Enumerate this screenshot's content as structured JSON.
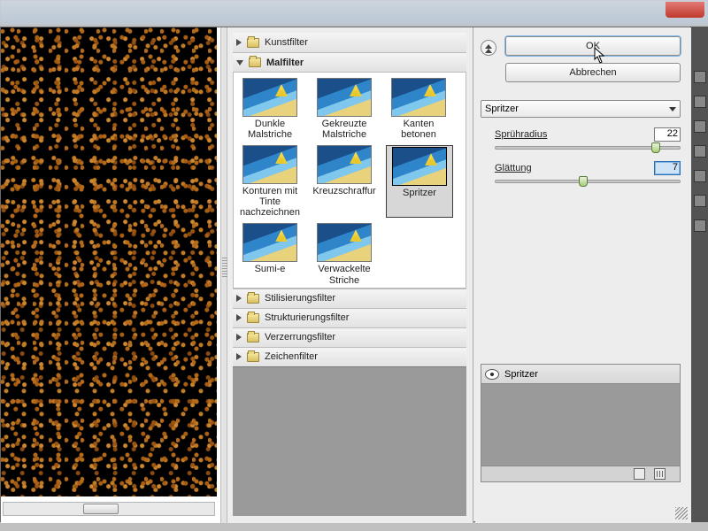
{
  "dialog": {
    "ok_label": "OK",
    "cancel_label": "Abbrechen"
  },
  "categories": {
    "kunstfilter": "Kunstfilter",
    "malfilter": "Malfilter",
    "stilisierung": "Stilisierungsfilter",
    "strukturierung": "Strukturierungsfilter",
    "verzerrung": "Verzerrungsfilter",
    "zeichen": "Zeichenfilter"
  },
  "thumbs": [
    {
      "label": "Dunkle Malstriche"
    },
    {
      "label": "Gekreuzte Malstriche"
    },
    {
      "label": "Kanten betonen"
    },
    {
      "label": "Konturen mit Tinte nachzeichnen"
    },
    {
      "label": "Kreuzschraffur"
    },
    {
      "label": "Spritzer"
    },
    {
      "label": "Sumi-e"
    },
    {
      "label": "Verwackelte Striche"
    }
  ],
  "selected_filter": "Spritzer",
  "params": {
    "spray": {
      "label": "Sprühradius",
      "value": "22",
      "pos": 176
    },
    "smooth": {
      "label": "Glättung",
      "value": "7",
      "pos": 94
    }
  },
  "layer_name": "Spritzer"
}
